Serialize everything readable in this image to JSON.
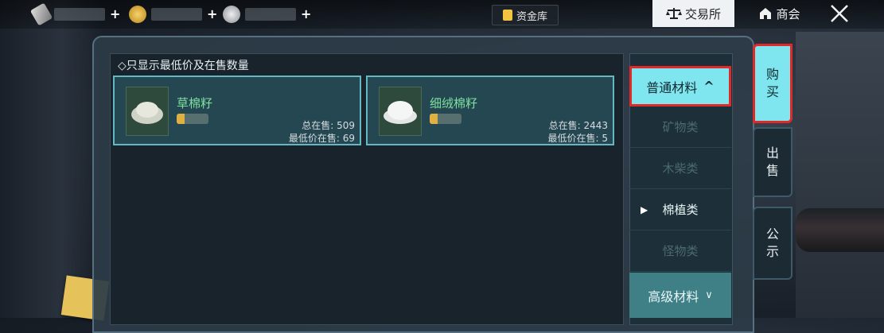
{
  "topbar": {
    "currencies": [
      {
        "icon": "feather-icon"
      },
      {
        "icon": "gold-coin-icon"
      },
      {
        "icon": "silver-coin-icon"
      }
    ],
    "plus": "+",
    "vault_label": "资金库",
    "exchange_label": "交易所",
    "shop_label": "商会"
  },
  "main": {
    "filter_text": "◇只显示最低价及在售数量",
    "items": [
      {
        "name": "草棉籽",
        "total_on_sale_label": "总在售:",
        "total_on_sale": "509",
        "lowest_label": "最低价在售:",
        "lowest_on_sale": "69"
      },
      {
        "name": "细绒棉籽",
        "total_on_sale_label": "总在售:",
        "total_on_sale": "2443",
        "lowest_label": "最低价在售:",
        "lowest_on_sale": "5"
      }
    ]
  },
  "categories": {
    "header": "普通材料",
    "header_chevron": "^",
    "items": [
      "矿物类",
      "木柴类",
      "棉植类",
      "怪物类"
    ],
    "active_index": 2,
    "active_marker": "▶",
    "advanced": "高级材料",
    "advanced_chevron": "∨"
  },
  "side_tabs": {
    "buy": [
      "购",
      "买"
    ],
    "sell": [
      "出",
      "售"
    ],
    "notice": [
      "公",
      "示"
    ]
  },
  "colors": {
    "accent": "#7fe5ee",
    "highlight_border": "#e02a2a",
    "item_name": "#7ee0a0"
  }
}
